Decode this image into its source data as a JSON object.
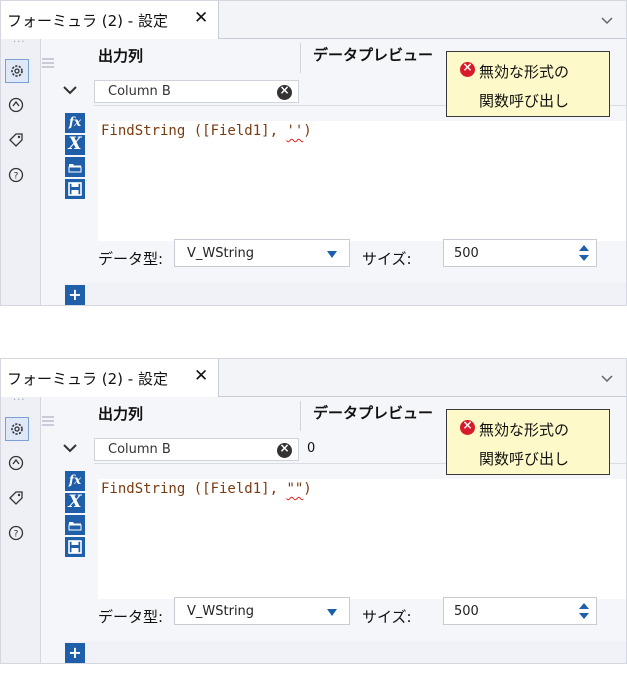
{
  "colors": {
    "accent": "#1f5fa9",
    "error": "#d81b2a",
    "tooltip_bg": "#fdf9c8",
    "expr_text": "#7b3b11"
  },
  "panels": [
    {
      "tab_title": "フォーミュラ (2) - 設定",
      "tab_close": "✕",
      "header_output_column": "出力列",
      "header_data_preview": "データプレビュー",
      "column_name": "Column B",
      "preview_value": "",
      "expression_prefix": "FindString ([Field1], ",
      "expression_error_part": "''",
      "expression_suffix": ")",
      "data_type_label": "データ型:",
      "data_type_value": "V_WString",
      "size_label": "サイズ:",
      "size_value": "500",
      "tooltip_line1": "無効な形式の",
      "tooltip_line2": "関数呼び出し",
      "fx_label": "fx",
      "x_label": "X",
      "add_label": "+"
    },
    {
      "tab_title": "フォーミュラ (2) - 設定",
      "tab_close": "✕",
      "header_output_column": "出力列",
      "header_data_preview": "データプレビュー",
      "column_name": "Column B",
      "preview_value": "0",
      "expression_prefix": "FindString ([Field1], ",
      "expression_error_part": "\"\"",
      "expression_suffix": ")",
      "data_type_label": "データ型:",
      "data_type_value": "V_WString",
      "size_label": "サイズ:",
      "size_value": "500",
      "tooltip_line1": "無効な形式の",
      "tooltip_line2": "関数呼び出し",
      "fx_label": "fx",
      "x_label": "X",
      "add_label": "+"
    }
  ],
  "icons": [
    "gear-icon",
    "navigate-icon",
    "tag-icon",
    "help-icon",
    "hamburger-icon",
    "chevron-down-icon",
    "fx-icon",
    "variable-x-icon",
    "open-folder-icon",
    "save-icon",
    "clear-icon",
    "error-icon",
    "spinner-icon",
    "add-icon"
  ]
}
